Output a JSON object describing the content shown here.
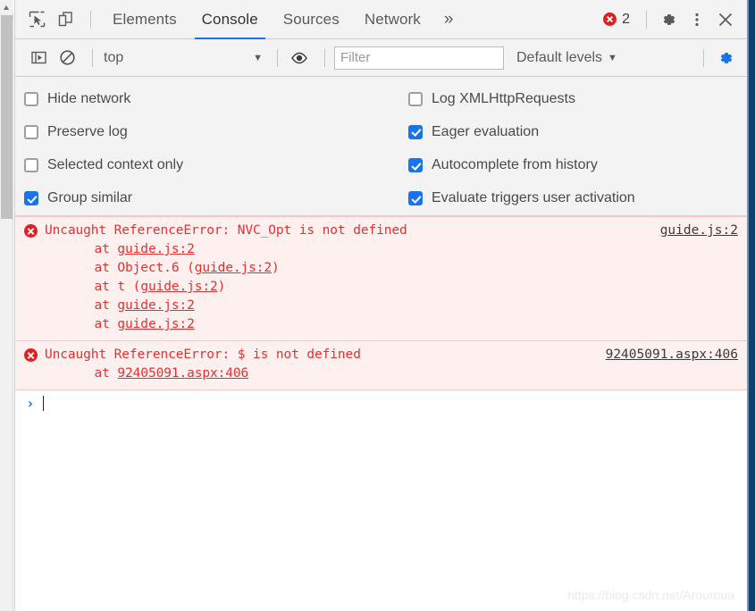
{
  "window": {
    "title": "Chrome DevTools - Console"
  },
  "toolbar": {
    "inspect_icon": "inspect-cursor-icon",
    "device_icon": "device-toolbar-icon",
    "tabs": [
      {
        "label": "Elements",
        "active": false
      },
      {
        "label": "Console",
        "active": true
      },
      {
        "label": "Sources",
        "active": false
      },
      {
        "label": "Network",
        "active": false
      }
    ],
    "more_tabs_label": "»",
    "error_count": "2",
    "settings_icon": "gear-icon",
    "more_options_icon": "kebab-menu-icon",
    "close_icon": "close-icon"
  },
  "filterbar": {
    "sidebar_toggle_icon": "console-sidebar-icon",
    "clear_icon": "clear-console-icon",
    "context_value": "top",
    "context_caret": "▼",
    "live_expression_icon": "eye-icon",
    "filter_value": "",
    "filter_placeholder": "Filter",
    "levels_label": "Default levels",
    "levels_caret": "▼",
    "console_settings_icon": "gear-icon"
  },
  "settings": {
    "left_options": [
      {
        "label": "Hide network",
        "checked": false
      },
      {
        "label": "Preserve log",
        "checked": false
      },
      {
        "label": "Selected context only",
        "checked": false
      },
      {
        "label": "Group similar",
        "checked": true
      }
    ],
    "right_options": [
      {
        "label": "Log XMLHttpRequests",
        "checked": false
      },
      {
        "label": "Eager evaluation",
        "checked": true
      },
      {
        "label": "Autocomplete from history",
        "checked": true
      },
      {
        "label": "Evaluate triggers user activation",
        "checked": true
      }
    ]
  },
  "console": {
    "messages": [
      {
        "level": "error",
        "text": "Uncaught ReferenceError: NVC_Opt is not defined",
        "source": "guide.js:2",
        "stack": [
          {
            "prefix": "    at ",
            "link": "guide.js:2",
            "suffix": ""
          },
          {
            "prefix": "    at Object.6 (",
            "link": "guide.js:2",
            "suffix": ")"
          },
          {
            "prefix": "    at t (",
            "link": "guide.js:2",
            "suffix": ")"
          },
          {
            "prefix": "    at ",
            "link": "guide.js:2",
            "suffix": ""
          },
          {
            "prefix": "    at ",
            "link": "guide.js:2",
            "suffix": ""
          }
        ]
      },
      {
        "level": "error",
        "text": "Uncaught ReferenceError: $ is not defined",
        "source": "92405091.aspx:406",
        "stack": [
          {
            "prefix": "    at ",
            "link": "92405091.aspx:406",
            "suffix": ""
          }
        ]
      }
    ],
    "prompt_arrow": "›",
    "prompt_value": ""
  },
  "watermark": {
    "text": "https://blog.csdn.net/Arouroua"
  },
  "colors": {
    "accent": "#1a73e8",
    "error_text": "#e53030",
    "error_bg": "#fff0f0",
    "error_border": "#f5c6c6",
    "toolbar_bg": "#f3f3f3",
    "right_strip": "#10406e"
  }
}
